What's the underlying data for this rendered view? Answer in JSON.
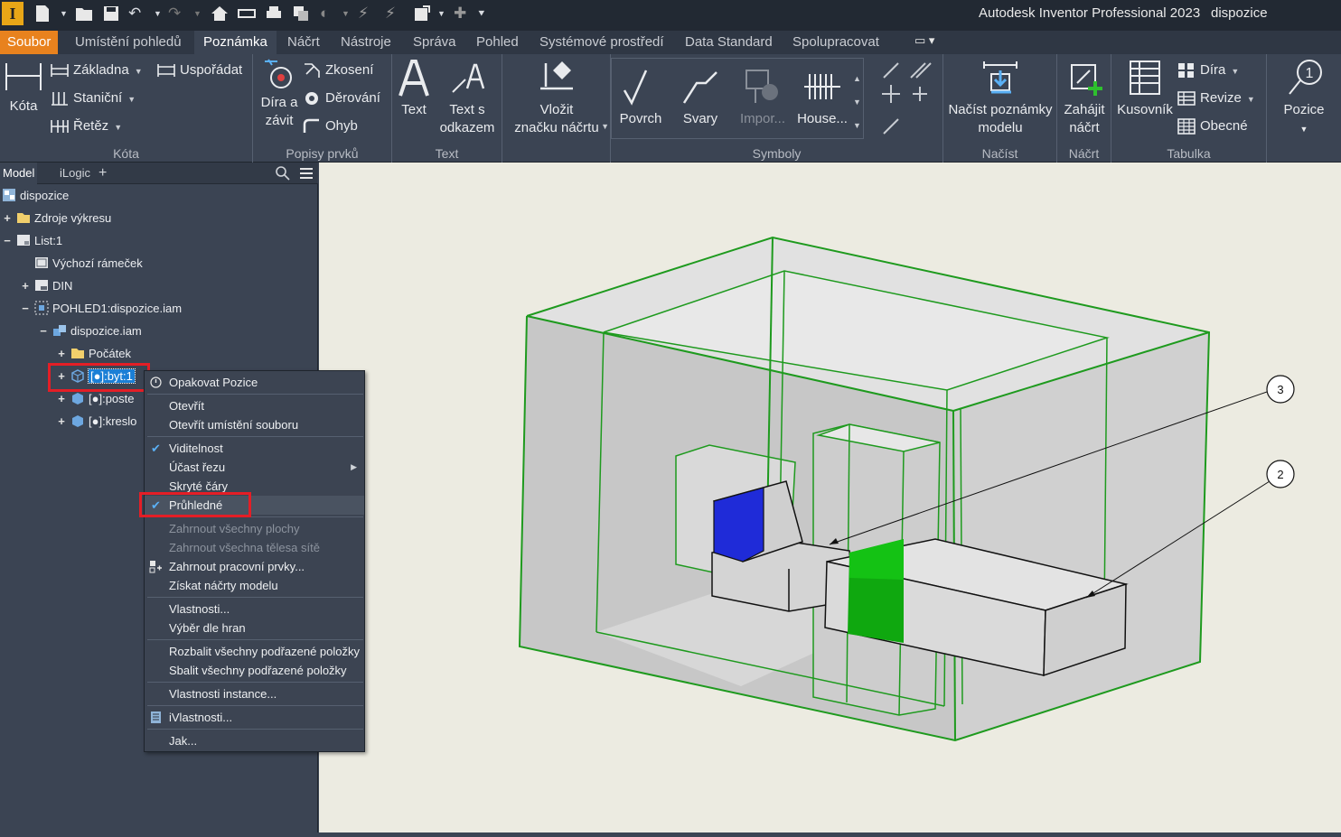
{
  "app": {
    "title": "Autodesk Inventor Professional 2023",
    "document": "dispozice",
    "logo_letter": "I"
  },
  "tabs": [
    "Soubor",
    "Umístění pohledů",
    "Poznámka",
    "Náčrt",
    "Nástroje",
    "Správa",
    "Pohled",
    "Systémové prostředí",
    "Data Standard",
    "Spolupracovat"
  ],
  "ribbon": {
    "kota": {
      "label": "Kóta",
      "big": "Kóta",
      "zakladna": "Základna",
      "usporadat": "Uspořádat",
      "stanicni": "Staniční",
      "retez": "Řetěz"
    },
    "popisy": {
      "label": "Popisy prvků",
      "dira_line1": "Díra a",
      "dira_line2": "závit",
      "zkoseni": "Zkosení",
      "derovani": "Děrování",
      "ohyb": "Ohyb"
    },
    "text": {
      "label": "Text",
      "text": "Text",
      "odkaz_line1": "Text s",
      "odkaz_line2": "odkazem"
    },
    "vlozit": {
      "line1": "Vložit",
      "line2": "značku náčrtu"
    },
    "symboly": {
      "label": "Symboly",
      "povrch": "Povrch",
      "svary": "Svary",
      "import": "Impor...",
      "house": "House..."
    },
    "nacist": {
      "label": "Načíst",
      "line1": "Načíst poznámky",
      "line2": "modelu"
    },
    "nacrt": {
      "label": "Náčrt",
      "line1": "Zahájit",
      "line2": "náčrt"
    },
    "tabulka": {
      "label": "Tabulka",
      "kusovnik": "Kusovník",
      "dira": "Díra",
      "revize": "Revize",
      "obecne": "Obecné"
    },
    "pozice": {
      "label": "Pozice",
      "badge": "1"
    }
  },
  "browser": {
    "tab_model": "Model",
    "tab_ilogic": "iLogic",
    "tab_add": "+",
    "tree": [
      {
        "label": "dispozice"
      },
      {
        "label": "Zdroje výkresu"
      },
      {
        "label": "List:1"
      },
      {
        "label": "Výchozí rámeček"
      },
      {
        "label": "DIN"
      },
      {
        "label": "POHLED1:dispozice.iam"
      },
      {
        "label": "dispozice.iam"
      },
      {
        "label": "Počátek"
      },
      {
        "label": "[●]:byt:1"
      },
      {
        "label": "[●]:poste"
      },
      {
        "label": "[●]:kreslo"
      }
    ]
  },
  "context_menu": {
    "items": [
      {
        "label": "Opakovat Pozice"
      },
      {
        "label": "Otevřít"
      },
      {
        "label": "Otevřít umístění souboru"
      },
      {
        "label": "Viditelnost"
      },
      {
        "label": "Účast řezu"
      },
      {
        "label": "Skryté čáry"
      },
      {
        "label": "Průhledné"
      },
      {
        "label": "Zahrnout všechny plochy"
      },
      {
        "label": "Zahrnout všechna tělesa sítě"
      },
      {
        "label": "Zahrnout pracovní prvky..."
      },
      {
        "label": "Získat náčrty modelu"
      },
      {
        "label": "Vlastnosti..."
      },
      {
        "label": "Výběr dle hran"
      },
      {
        "label": "Rozbalit všechny podřazené položky"
      },
      {
        "label": "Sbalit všechny podřazené položky"
      },
      {
        "label": "Vlastnosti instance..."
      },
      {
        "label": "iVlastnosti..."
      },
      {
        "label": "Jak..."
      }
    ]
  },
  "balloons": {
    "b3": "3",
    "b2": "2"
  },
  "colors": {
    "accent_file": "#e8821e",
    "selection": "#1b7fd6",
    "highlight_box": "#e41e26",
    "edge_green": "#1e9a1e"
  }
}
